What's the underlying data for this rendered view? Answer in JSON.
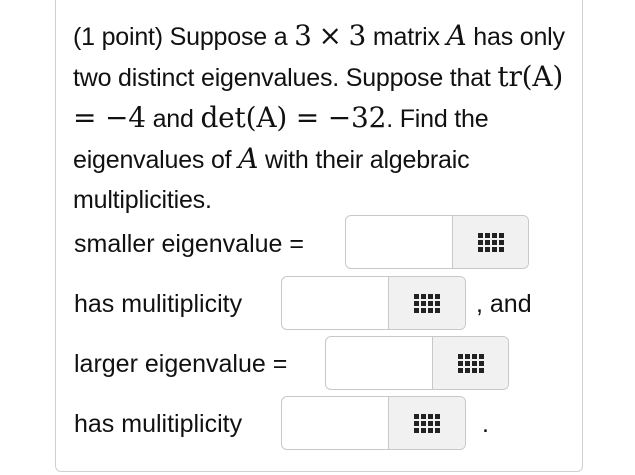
{
  "problem": {
    "text_1": "(1 point) Suppose a ",
    "dim_1": "3",
    "times": "×",
    "dim_2": "3",
    "text_2": " matrix ",
    "matrix": "A",
    "text_3": " has only two distinct eigenvalues. Suppose that ",
    "trace_expr": "tr(A) = −4",
    "text_4": " and ",
    "det_expr": "det(A) = −32",
    "text_5": ". Find the eigenvalues of ",
    "matrix_2": "A",
    "text_6": " with their algebraic multiplicities."
  },
  "answers": [
    {
      "label": "smaller eigenvalue =",
      "value": "",
      "suffix": ""
    },
    {
      "label": "has mulitiplicity",
      "value": "",
      "suffix": ", and"
    },
    {
      "label": "larger eigenvalue =",
      "value": "",
      "suffix": ""
    },
    {
      "label": "has mulitiplicity",
      "value": "",
      "suffix": "."
    }
  ],
  "icons": {
    "palette": "matrix-palette-icon"
  }
}
